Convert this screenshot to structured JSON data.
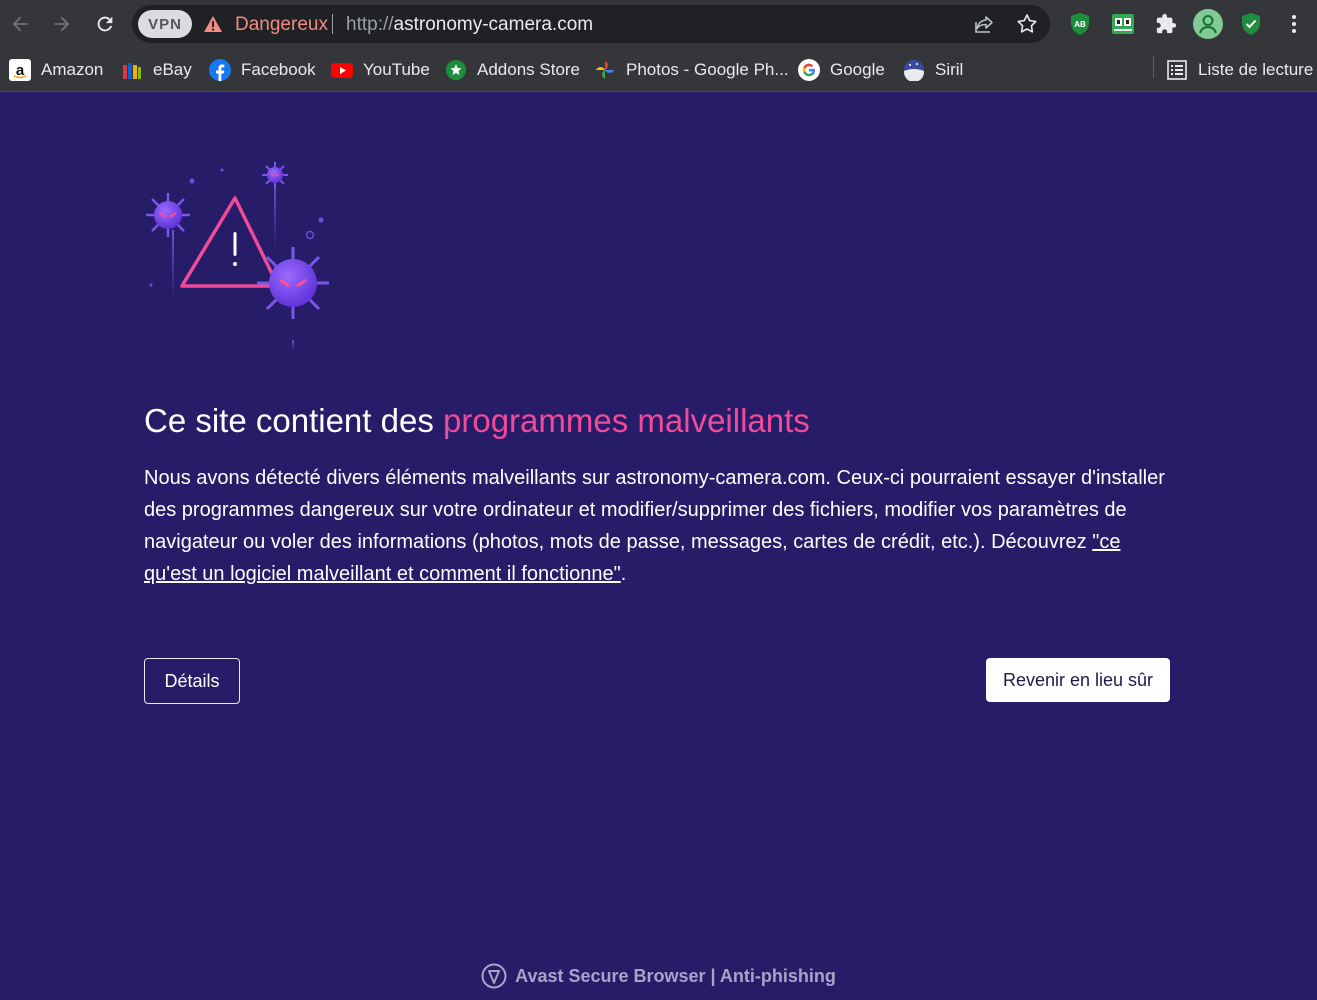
{
  "browser": {
    "vpn_label": "VPN",
    "security_label": "Dangereux",
    "url_scheme": "http://",
    "url_host": "astronomy-camera.com",
    "extensions": [
      "adblock-icon",
      "video-extension-icon",
      "extensions-puzzle-icon",
      "profile-avatar-icon",
      "shield-check-icon",
      "menu-dots-icon"
    ]
  },
  "bookmarks": [
    {
      "label": "Amazon",
      "icon": "amazon-icon"
    },
    {
      "label": "eBay",
      "icon": "ebay-icon"
    },
    {
      "label": "Facebook",
      "icon": "facebook-icon"
    },
    {
      "label": "YouTube",
      "icon": "youtube-icon"
    },
    {
      "label": "Addons Store",
      "icon": "addons-store-icon"
    },
    {
      "label": "Photos - Google Ph...",
      "icon": "google-photos-icon"
    },
    {
      "label": "Google",
      "icon": "google-icon"
    },
    {
      "label": "Siril",
      "icon": "siril-icon"
    }
  ],
  "reading_list_label": "Liste de lecture",
  "page": {
    "headline_prefix": "Ce site contient des ",
    "headline_accent": "programmes malveillants",
    "description": "Nous avons détecté divers éléments malveillants sur astronomy-camera.com. Ceux-ci pourraient essayer d'installer des programmes dangereux sur votre ordinateur et modifier/supprimer des fichiers, modifier vos paramètres de navigateur ou voler des informations (photos, mots de passe, messages, cartes de crédit, etc.). Découvrez ",
    "learn_more_link": "\"ce qu'est un logiciel malveillant et comment il fonctionne\"",
    "description_end": ".",
    "details_button": "Détails",
    "back_button": "Revenir en lieu sûr",
    "footer": "Avast Secure Browser | Anti-phishing"
  },
  "colors": {
    "background": "#261c68",
    "accent": "#ef4b9a",
    "chrome": "#35363a"
  }
}
